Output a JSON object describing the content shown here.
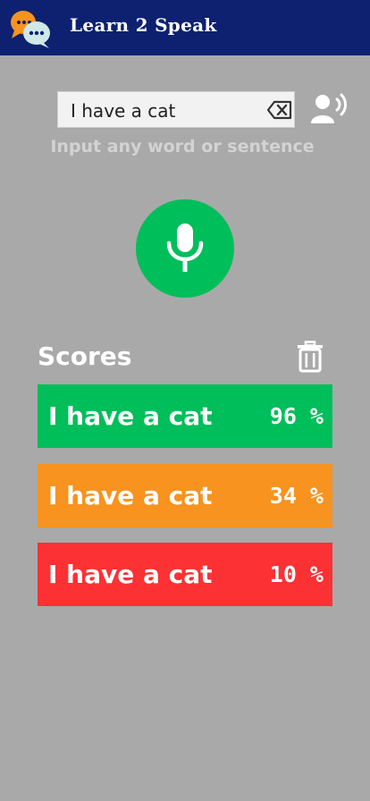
{
  "header": {
    "title": "Learn 2 Speak",
    "logo_icon": "chat-bubbles-icon",
    "bg_color": "#0d2170"
  },
  "input": {
    "value": "I have a cat",
    "hint": "Input any word or sentence",
    "clear_icon": "backspace-icon",
    "speak_icon": "speaker-person-icon"
  },
  "mic": {
    "icon": "microphone-icon",
    "color": "#00be5a"
  },
  "scores": {
    "title": "Scores",
    "clear_icon": "trash-icon",
    "items": [
      {
        "text": "I have a cat",
        "score": "96 %",
        "color": "#00be5a"
      },
      {
        "text": "I have a cat",
        "score": "34 %",
        "color": "#f7931e"
      },
      {
        "text": "I have a cat",
        "score": "10 %",
        "color": "#fc3134"
      }
    ]
  }
}
